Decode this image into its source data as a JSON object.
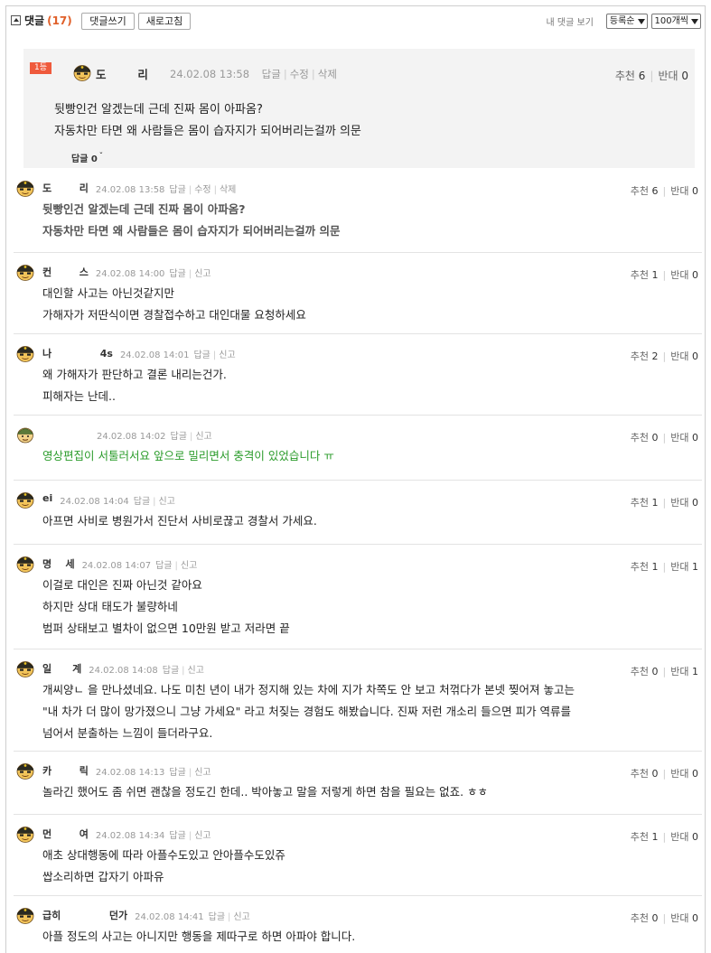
{
  "header": {
    "title": "댓글",
    "count": "(17)",
    "write_button": "댓글쓰기",
    "refresh_button": "새로고침",
    "my_comments": "내 댓글 보기",
    "sort_value": "등록순",
    "page_size_value": "100개씩"
  },
  "best": {
    "rank": "1등",
    "nick": "도        리",
    "time": "24.02.08 13:58",
    "actions": [
      "답글",
      "수정",
      "삭제"
    ],
    "lines": [
      "뒷빵인건 알겠는데 근데 진짜 몸이 아파옴?",
      "자동차만 타면 왜 사람들은 몸이 습자지가 되어버리는걸까 의문"
    ],
    "reply_toggle": "답글 0",
    "up_label": "추천",
    "up": "6",
    "down_label": "반대",
    "down": "0"
  },
  "comments": [
    {
      "nick": "도        리",
      "time": "24.02.08 13:58",
      "actions": [
        "답글",
        "수정",
        "삭제"
      ],
      "lines": [
        "뒷빵인건 알겠는데 근데 진짜 몸이 아파옴?",
        "자동차만 타면 왜 사람들은 몸이 습자지가 되어버리는걸까 의문"
      ],
      "up": "6",
      "down": "0"
    },
    {
      "nick": "컨        스",
      "time": "24.02.08 14:00",
      "actions": [
        "답글",
        "신고"
      ],
      "lines": [
        "대인할 사고는 아닌것같지만",
        "가해자가 저딴식이면 경찰접수하고 대인대물 요청하세요"
      ],
      "up": "1",
      "down": "0"
    },
    {
      "nick": "나              4s",
      "time": "24.02.08 14:01",
      "actions": [
        "답글",
        "신고"
      ],
      "lines": [
        "왜 가해자가 판단하고 결론 내리는건가.",
        "피해자는 난데.."
      ],
      "up": "2",
      "down": "0"
    },
    {
      "nick": "",
      "time": "24.02.08 14:02",
      "actions": [
        "답글",
        "신고"
      ],
      "lines": [
        "영상편집이 서툴러서요 앞으로 밀리면서 충격이 있었습니다 ㅠ"
      ],
      "up": "0",
      "down": "0"
    },
    {
      "nick": "ei",
      "time": "24.02.08 14:04",
      "actions": [
        "답글",
        "신고"
      ],
      "lines": [
        "아프면 사비로 병원가서 진단서 사비로끊고 경찰서 가세요."
      ],
      "up": "1",
      "down": "0"
    },
    {
      "nick": "명    세",
      "time": "24.02.08 14:07",
      "actions": [
        "답글",
        "신고"
      ],
      "lines": [
        "이걸로 대인은 진짜 아닌것 같아요",
        "하지만 상대 태도가 불량하네",
        "범퍼 상태보고 별차이 없으면 10만원 받고 저라면 끝"
      ],
      "up": "1",
      "down": "1"
    },
    {
      "nick": "일      계",
      "time": "24.02.08 14:08",
      "actions": [
        "답글",
        "신고"
      ],
      "lines": [
        "개씨양ㄴ 을 만나셨네요. 나도 미친 년이 내가 정지해 있는 차에 지가 차쪽도 안 보고 처꺾다가 본넷 찢어져 놓고는",
        "\"내 차가 더 많이 망가졌으니 그냥 가세요\" 라고 처짖는 경험도 해봤습니다. 진짜 저런 개소리 들으면 피가 역류를",
        "넘어서 분출하는 느낌이 들더라구요."
      ],
      "up": "0",
      "down": "1"
    },
    {
      "nick": "카        릭",
      "time": "24.02.08 14:13",
      "actions": [
        "답글",
        "신고"
      ],
      "lines": [
        "놀라긴 했어도 좀 쉬면 괜찮을 정도긴 한데.. 박아놓고 말을 저렇게 하면 참을 필요는 없죠. ㅎㅎ"
      ],
      "up": "0",
      "down": "0"
    },
    {
      "nick": "먼        여",
      "time": "24.02.08 14:34",
      "actions": [
        "답글",
        "신고"
      ],
      "lines": [
        "애초 상대행동에 따라 아플수도있고 안아플수도있쥬",
        "쌉소리하면 갑자기 아파유"
      ],
      "up": "1",
      "down": "0"
    },
    {
      "nick": "급히              던가",
      "time": "24.02.08 14:41",
      "actions": [
        "답글",
        "신고"
      ],
      "lines": [
        "아플 정도의 사고는 아니지만 행동을 제따구로 하면 아파야 합니다."
      ],
      "up": "0",
      "down": "0"
    }
  ],
  "labels": {
    "up": "추천",
    "down": "반대"
  },
  "colors": {
    "count": "#e0602a",
    "badge": "#ef5a3c",
    "green_text": "#2a9b2a"
  },
  "icons": {
    "avatar": "soldier-avatar-icon",
    "avatar_alt": "green-helmet-avatar-icon",
    "collapse": "collapse-icon",
    "caret": "chevron-down-icon"
  }
}
